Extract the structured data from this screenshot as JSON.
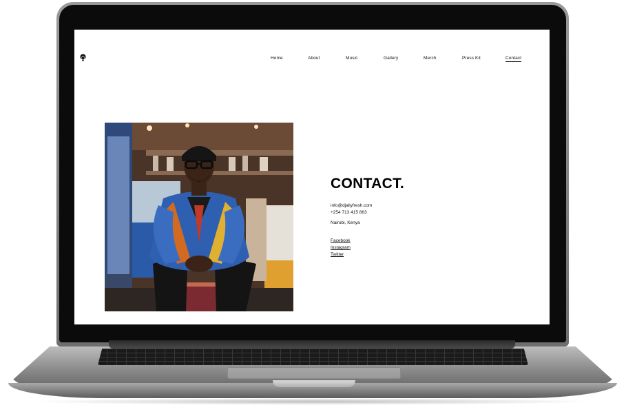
{
  "site": {
    "logo_icon": "afro-face-logo-icon"
  },
  "nav": {
    "items": [
      {
        "label": "Home"
      },
      {
        "label": "About"
      },
      {
        "label": "Music"
      },
      {
        "label": "Gallery"
      },
      {
        "label": "Merch"
      },
      {
        "label": "Press Kit"
      },
      {
        "label": "Contact",
        "active": true
      }
    ]
  },
  "contact": {
    "title": "CONTACT.",
    "email": "info@djallyfresh.com",
    "phone": "+254 713 415 863",
    "location": "Nairobi, Kenya",
    "social": {
      "facebook": "Facebook",
      "instagram": "Instagram",
      "twitter": "Twitter"
    }
  },
  "colors": {
    "laptop_silver": "#9a9a9a",
    "bezel": "#0b0b0b",
    "text": "#111111",
    "shirt_blue": "#2f5fb0",
    "shirt_orange": "#d26a22"
  }
}
